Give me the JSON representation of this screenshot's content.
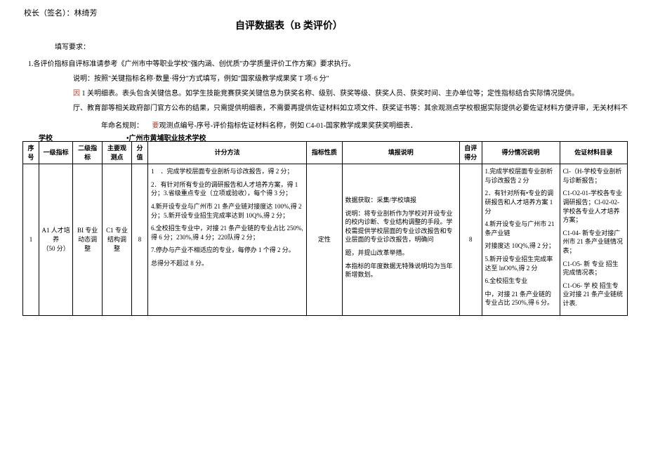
{
  "top": {
    "signature": "校长（签名）：林绮芳"
  },
  "title": "自评数据表（B 类评价）",
  "labels": {
    "fill_requirement": "填写要求：",
    "para1": "1.各评价指标自评标准请参考《广州市中等职业学校\"强内涵、创优质\"办学质量评价工作方案》要求执行。",
    "para2": "说明：按照\"关键指标名称·数量·得分\"方式填写，例如\"国家级教学成果奖 T 项·6 分\"",
    "para3": "因 1 关明细表。表头包含关键信息。如学生技能竞赛获奖关键信息为获奖名称、级别、获奖等级、获奖人员、获奖时间、主办单位等；定性指标结合实际情况提供。",
    "para4": "厅、教育部等相关政府部门官方公布的结果，只需提供明细表，不需要再提供佐证材料如立项文件、获奖证书等：其余观测点学校根据实际提供必要佐证材料方便评审，无关材料不",
    "para5_a": "年命名规则：",
    "para5_b": "要观测点编号-序号-评价指标佐证材料名称，例如 C4-01-国家教学成果奖获奖明细表．",
    "school_label": "学校",
    "school_name": "•广州市黄埔职业技术学校"
  },
  "table": {
    "headers": [
      "序号",
      "一级指标",
      "二级指标",
      "主要观测点",
      "分值",
      "计分方法",
      "指标性质",
      "填报说明",
      "自评得分",
      "得分情况说明",
      "佐证材料目录"
    ],
    "row": {
      "seq": "1",
      "level1": "A1 人才培\n养\n（50 分）",
      "level2": "BI 专业动态调整",
      "level3": "C1 专业结构调整",
      "score_value": "8",
      "method": "1　．完成学校层面专业剖析与诊改报告，得 2 分；\n2．有针对所有专业的调研报告和人才培养方案，得 1 分；3.省级重点专业（立项或验收），每个得 3 分；\n4.新开设专业与广州市 21 条产业链对接度达 100%,得 2 分；5.新开设专业招生完成率达到 10Q%,得 2 分；\n6.全校招生专业中，对接 21 条产业链的专业占比 250%,得 6 分；230%,得 4 分；220队得 2 分；\n7.停办与产业不相适应的专业，每停办 1 个得 2 分。\n总得分不超过 8 分。",
      "nature": "定性",
      "instruction": "数据获取：采集/学校填报\n说明：将专业剖析作为学校对开设专业的校内诊断、专业结构调整的手段。学校需提供学校层面的专业诊改报告和专业层面的专业诊改报告，明确问\n题，并提山改革举措。\n本指标的年度数据无特殊说明均为当年新增数划。",
      "self_score": "8",
      "score_desc": "1.完成学校层面专业剖析与诊改报告 2 分\n2．有针对所有•专业的调研报告和人才培养方案 1分\n4.新开设专业与广州市 21 条产业链\n对接度达 10Q%,得 2 分；\n5.新开设专业招生完成率达至 lnO0%,得 2 分\n6.全校招生专业\n中，对接 21 条产业链的专业占比 250%,得 6 分。",
      "materials": "Cl-（H-学校专业剖析与诊断报告；\nC1-O2-01-学校各专业调研报告；Cl-02-02-学校各专业人才培养方案；\nC1-04- 新专业对接广州市 21 条产业链情况表；\nC1-O5- 新 专业 招生完成情况表；\nC1-O6- 学 校 招生专业对接 21 条产业链统计表."
    }
  }
}
